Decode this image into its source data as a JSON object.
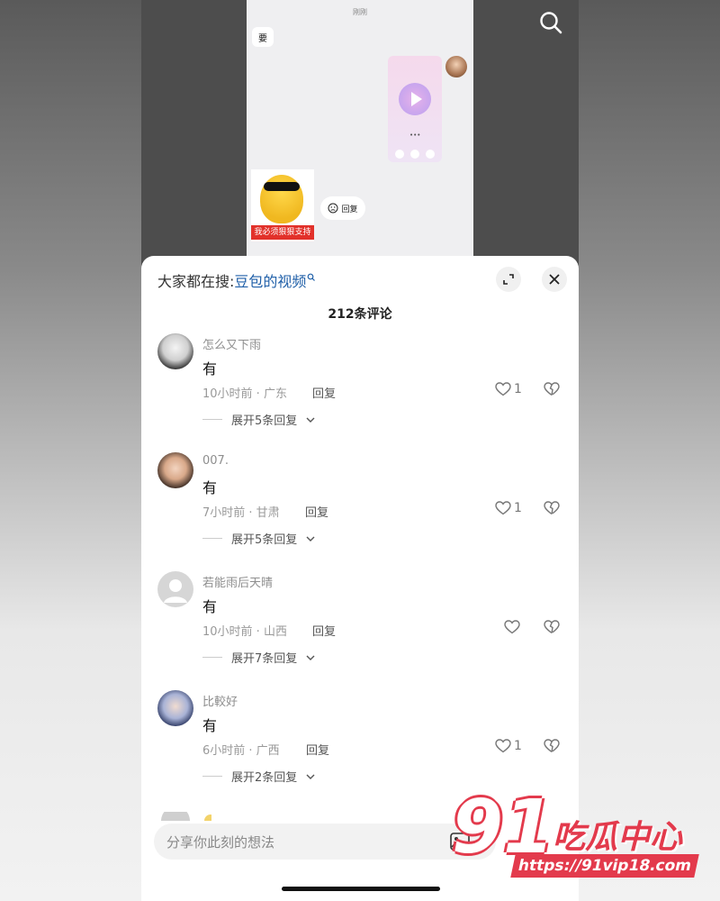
{
  "video": {
    "chat_time": "刚刚",
    "chat_bubble": "要",
    "sticker_label": "我必须狠狠支持",
    "reply_chip": "回复"
  },
  "sheet": {
    "search_prefix": "大家都在搜:",
    "search_link": "豆包的视频",
    "comment_count": "212条评论",
    "input_placeholder": "分享你此刻的想法"
  },
  "comments": [
    {
      "name": "怎么又下雨",
      "text": "有",
      "meta": "10小时前 · 广东",
      "reply": "回复",
      "likes": "1",
      "expand": "展开5条回复"
    },
    {
      "name": "007.",
      "text": "有",
      "meta": "7小时前 · 甘肃",
      "reply": "回复",
      "likes": "1",
      "expand": "展开5条回复"
    },
    {
      "name": "若能雨后天晴",
      "text": "有",
      "meta": "10小时前 · 山西",
      "reply": "回复",
      "likes": "",
      "expand": "展开7条回复"
    },
    {
      "name": "比較好",
      "text": "有",
      "meta": "6小时前 · 广西",
      "reply": "回复",
      "likes": "1",
      "expand": "展开2条回复"
    }
  ],
  "watermark": {
    "number": "91",
    "brand": "吃瓜中心",
    "url": "https://91vip18.com"
  },
  "colors": {
    "link": "#1f5fa8",
    "watermark_red": "#e33a4c"
  }
}
